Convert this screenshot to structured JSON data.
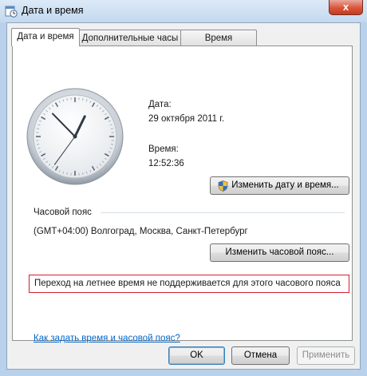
{
  "window": {
    "title": "Дата и время",
    "close_label": "x"
  },
  "tabs": [
    {
      "label": "Дата и время",
      "active": true
    },
    {
      "label": "Дополнительные часы",
      "active": false
    },
    {
      "label": "Время Интернета",
      "active": false
    }
  ],
  "date_section": {
    "date_label": "Дата:",
    "date_value": "29 октября 2011 г.",
    "time_label": "Время:",
    "time_value": "12:52:36",
    "change_datetime_button": "Изменить дату и время..."
  },
  "timezone_section": {
    "heading": "Часовой пояс",
    "value": "(GMT+04:00) Волгоград, Москва, Санкт-Петербург",
    "change_timezone_button": "Изменить часовой пояс..."
  },
  "dst_notice": "Переход на летнее время не поддерживается для этого часового пояса",
  "help_link": "Как задать время и часовой пояс?",
  "footer": {
    "ok": "OK",
    "cancel": "Отмена",
    "apply": "Применить"
  },
  "icons": {
    "title": "clock-calendar-icon",
    "shield": "uac-shield-icon"
  }
}
